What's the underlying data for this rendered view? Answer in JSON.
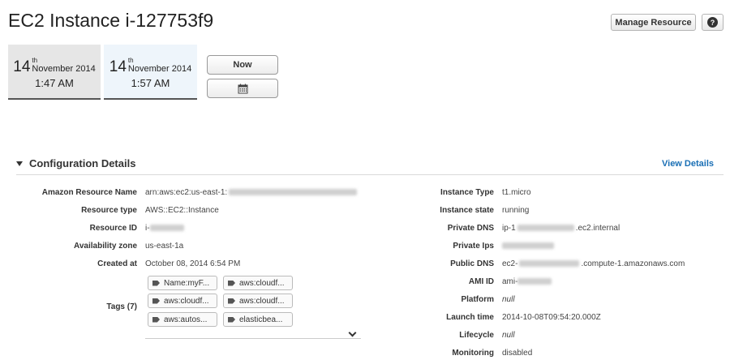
{
  "header": {
    "title": "EC2 Instance i-127753f9",
    "manage_label": "Manage Resource",
    "help_icon": "question-circle-icon",
    "help_label": "?"
  },
  "timeline": {
    "cards": [
      {
        "day": "14",
        "suffix": "th",
        "month": "November 2014",
        "time": "1:47 AM"
      },
      {
        "day": "14",
        "suffix": "th",
        "month": "November 2014",
        "time": "1:57 AM"
      }
    ],
    "now_label": "Now",
    "calendar_icon": "calendar-icon"
  },
  "section": {
    "title": "Configuration Details",
    "view_details": "View Details",
    "left": {
      "arn_label": "Amazon Resource Name",
      "arn_value": "arn:aws:ec2:us-east-1:",
      "type_label": "Resource type",
      "type_value": "AWS::EC2::Instance",
      "id_label": "Resource ID",
      "id_value": "i-",
      "az_label": "Availability zone",
      "az_value": "us-east-1a",
      "created_label": "Created at",
      "created_value": "October 08, 2014 6:54 PM",
      "tags_label": "Tags (7)",
      "tags": [
        "Name:myF...",
        "aws:cloudf...",
        "aws:cloudf...",
        "aws:cloudf...",
        "aws:autos...",
        "elasticbea..."
      ]
    },
    "right": {
      "type_label": "Instance Type",
      "type_value": "t1.micro",
      "state_label": "Instance state",
      "state_value": "running",
      "pdns_label": "Private DNS",
      "pdns_prefix": "ip-1",
      "pdns_suffix": ".ec2.internal",
      "pips_label": "Private Ips",
      "pubdns_label": "Public DNS",
      "pubdns_prefix": "ec2-",
      "pubdns_suffix": ".compute-1.amazonaws.com",
      "ami_label": "AMI ID",
      "ami_prefix": "ami-",
      "platform_label": "Platform",
      "platform_value": "null",
      "launch_label": "Launch time",
      "launch_value": "2014-10-08T09:54:20.000Z",
      "lifecycle_label": "Lifecycle",
      "lifecycle_value": "null",
      "monitoring_label": "Monitoring",
      "monitoring_value": "disabled"
    }
  },
  "colors": {
    "link": "#1a6fb5",
    "selected_card": "#eef5fb",
    "card": "#e6e6e6"
  }
}
